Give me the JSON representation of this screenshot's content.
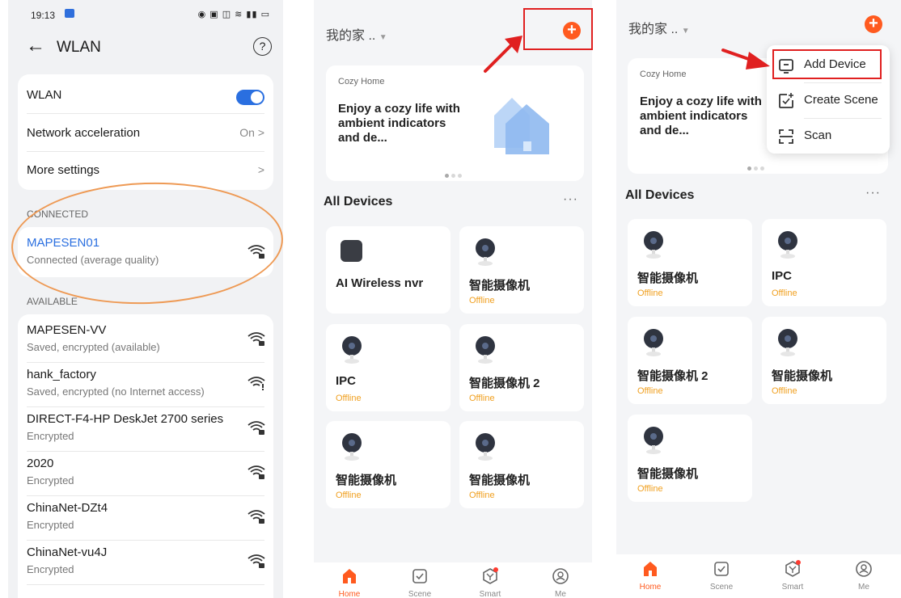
{
  "wlan": {
    "status_time": "19:13",
    "title": "WLAN",
    "settings": [
      {
        "label": "WLAN",
        "value": ""
      },
      {
        "label": "Network acceleration",
        "value": "On"
      },
      {
        "label": "More settings",
        "value": ""
      }
    ],
    "connected_header": "CONNECTED",
    "connected": {
      "name": "MAPESEN01",
      "status": "Connected (average quality)"
    },
    "available_header": "AVAILABLE",
    "available": [
      {
        "name": "MAPESEN-VV",
        "status": "Saved, encrypted (available)"
      },
      {
        "name": "hank_factory",
        "status": "Saved, encrypted (no Internet access)"
      },
      {
        "name": "DIRECT-F4-HP DeskJet 2700 series",
        "status": "Encrypted"
      },
      {
        "name": "2020",
        "status": "Encrypted"
      },
      {
        "name": "ChinaNet-DZt4",
        "status": "Encrypted"
      },
      {
        "name": "ChinaNet-vu4J",
        "status": "Encrypted"
      }
    ]
  },
  "app": {
    "home_name": "我的家 ..",
    "banner": {
      "label": "Cozy Home",
      "title": "Enjoy a cozy life with ambient indicators and de..."
    },
    "section_title": "All Devices",
    "more_label": "···",
    "devices_screen2": [
      {
        "name": "AI Wireless nvr",
        "status": "",
        "kind": "nvr"
      },
      {
        "name": "智能摄像机",
        "status": "Offline",
        "kind": "camera"
      },
      {
        "name": "IPC",
        "status": "Offline",
        "kind": "camera"
      },
      {
        "name": "智能摄像机 2",
        "status": "Offline",
        "kind": "camera"
      },
      {
        "name": "智能摄像机",
        "status": "Offline",
        "kind": "camera"
      },
      {
        "name": "智能摄像机",
        "status": "Offline",
        "kind": "camera"
      }
    ],
    "devices_screen3": [
      {
        "name": "智能摄像机",
        "status": "Offline"
      },
      {
        "name": "IPC",
        "status": "Offline"
      },
      {
        "name": "智能摄像机 2",
        "status": "Offline"
      },
      {
        "name": "智能摄像机",
        "status": "Offline"
      },
      {
        "name": "智能摄像机",
        "status": "Offline"
      }
    ],
    "tabs": [
      "Home",
      "Scene",
      "Smart",
      "Me"
    ],
    "menu": {
      "add_device": "Add Device",
      "create_scene": "Create Scene",
      "scan": "Scan"
    },
    "colors": {
      "accent": "#ff5a1f",
      "offline": "#f0a020",
      "annotation": "#e02020",
      "wlan_blue": "#2a6fe0"
    }
  }
}
